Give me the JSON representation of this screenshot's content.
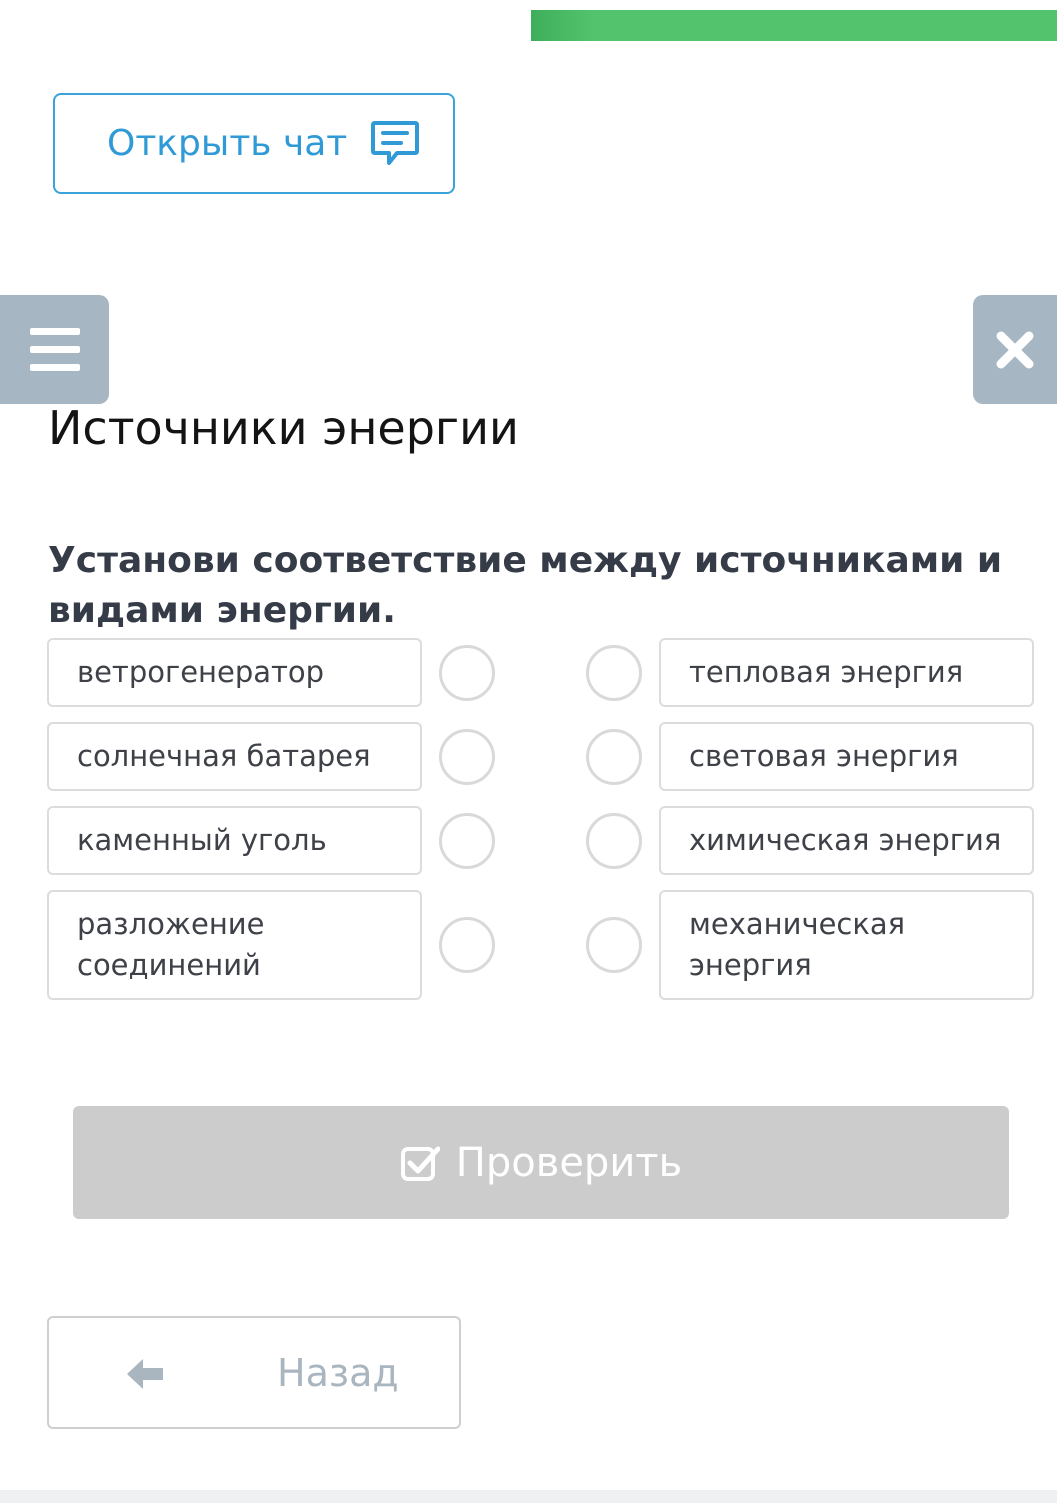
{
  "header": {
    "progress_color": "#53c46d",
    "chat_button_label": "Открыть чат",
    "chat_icon": "chat-icon",
    "menu_icon": "hamburger-menu-icon",
    "close_icon": "close-icon"
  },
  "page_title": "Источники энергии",
  "task": "Установи соответствие между источниками и видами энергии.",
  "sources": [
    "ветрогенератор",
    "солнечная батарея",
    "каменный уголь",
    "разложение соединений"
  ],
  "energy_types": [
    "тепловая энергия",
    "световая энергия",
    "химическая энергия",
    "механическая энергия"
  ],
  "check_button": {
    "label": "Проверить",
    "icon": "checkbox-check-icon"
  },
  "back_button": {
    "label": "Назад",
    "icon": "arrow-left-icon"
  },
  "colors": {
    "accent_blue": "#2f9ad6",
    "side_button": "#a6b7c3",
    "disabled_button": "#cccccc"
  }
}
